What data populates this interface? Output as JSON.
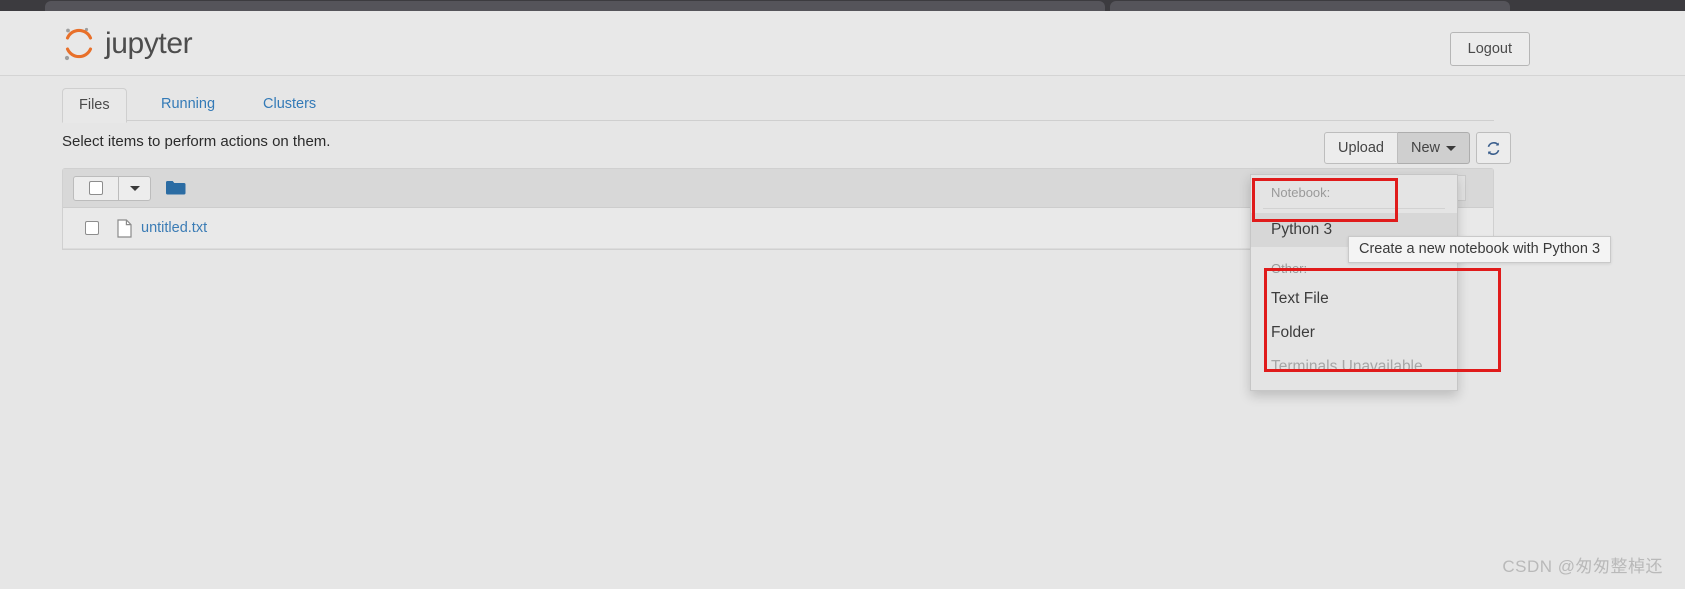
{
  "browser": {
    "tab_primary": "",
    "tab_secondary": ""
  },
  "header": {
    "logo_text": "jupyter",
    "logo_icon": "jupyter-logo-icon",
    "logout_label": "Logout"
  },
  "tabs": [
    {
      "label": "Files",
      "active": true
    },
    {
      "label": "Running",
      "active": false
    },
    {
      "label": "Clusters",
      "active": false
    }
  ],
  "notice": "Select items to perform actions on them.",
  "toolbar": {
    "upload_label": "Upload",
    "new_label": "New",
    "new_caret_icon": "chevron-down-icon",
    "refresh_icon": "refresh-icon"
  },
  "file_table": {
    "header": {
      "select_all_checkbox": "",
      "select_caret_icon": "chevron-down-icon",
      "folder_icon": "folder-icon",
      "sort_arrow_icon": "arrow-up-icon"
    },
    "rows": [
      {
        "checkbox": "",
        "icon": "file-icon",
        "name": "untitled.txt"
      }
    ]
  },
  "dropdown": {
    "notebook_header": "Notebook:",
    "notebook_items": [
      {
        "label": "Python 3",
        "hovered": true,
        "disabled": false
      }
    ],
    "other_header": "Other:",
    "other_items": [
      {
        "label": "Text File",
        "hovered": false,
        "disabled": false
      },
      {
        "label": "Folder",
        "hovered": false,
        "disabled": false
      },
      {
        "label": "Terminals Unavailable",
        "hovered": false,
        "disabled": true
      }
    ]
  },
  "tooltip": {
    "text": "Create a new notebook with Python 3"
  },
  "annotations": {
    "accent_color": "#e01b1b",
    "boxes": [
      {
        "target": "Python 3"
      },
      {
        "target": "Other items group"
      }
    ]
  },
  "watermark": {
    "text": "CSDN @匆匆整棹还"
  }
}
